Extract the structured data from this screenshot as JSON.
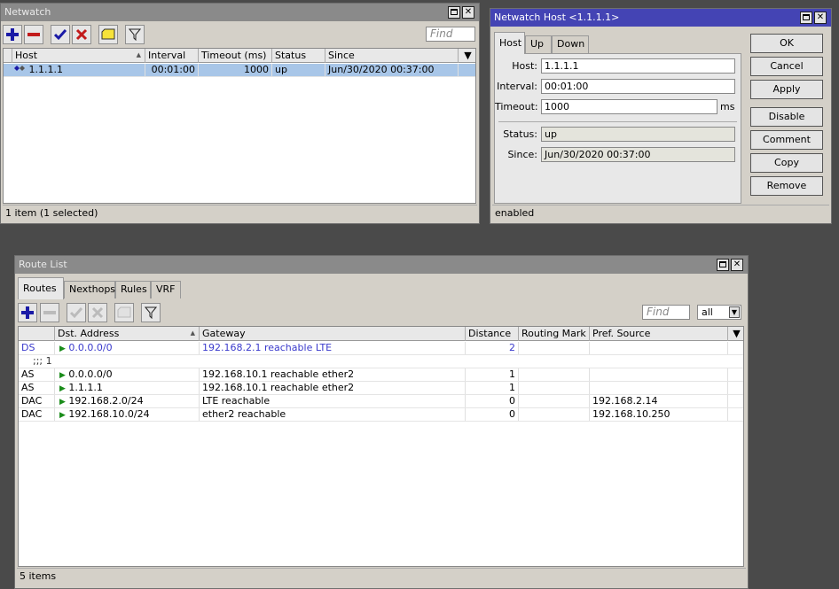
{
  "netwatch": {
    "title": "Netwatch",
    "find_placeholder": "Find",
    "columns": [
      "Host",
      "Interval",
      "Timeout (ms)",
      "Status",
      "Since"
    ],
    "rows": [
      {
        "host": "1.1.1.1",
        "interval": "00:01:00",
        "timeout": "1000",
        "status": "up",
        "since": "Jun/30/2020 00:37:00"
      }
    ],
    "status_text": "1 item (1 selected)"
  },
  "host_dialog": {
    "title": "Netwatch Host <1.1.1.1>",
    "tabs": [
      "Host",
      "Up",
      "Down"
    ],
    "fields": {
      "host_label": "Host:",
      "host_value": "1.1.1.1",
      "interval_label": "Interval:",
      "interval_value": "00:01:00",
      "timeout_label": "Timeout:",
      "timeout_value": "1000",
      "timeout_unit": "ms",
      "status_label": "Status:",
      "status_value": "up",
      "since_label": "Since:",
      "since_value": "Jun/30/2020 00:37:00"
    },
    "buttons": [
      "OK",
      "Cancel",
      "Apply",
      "Disable",
      "Comment",
      "Copy",
      "Remove"
    ],
    "status_text": "enabled"
  },
  "route_list": {
    "title": "Route List",
    "tabs": [
      "Routes",
      "Nexthops",
      "Rules",
      "VRF"
    ],
    "find_placeholder": "Find",
    "filter_value": "all",
    "columns": [
      "",
      "Dst. Address",
      "Gateway",
      "Distance",
      "Routing Mark",
      "Pref. Source"
    ],
    "rows": [
      {
        "flags": "DS",
        "dst": "0.0.0.0/0",
        "gateway": "192.168.2.1 reachable LTE",
        "distance": "2",
        "routing_mark": "",
        "pref_source": ""
      },
      {
        "comment": ";;; 1"
      },
      {
        "flags": "AS",
        "dst": "0.0.0.0/0",
        "gateway": "192.168.10.1 reachable ether2",
        "distance": "1",
        "routing_mark": "",
        "pref_source": ""
      },
      {
        "flags": "AS",
        "dst": "1.1.1.1",
        "gateway": "192.168.10.1 reachable ether2",
        "distance": "1",
        "routing_mark": "",
        "pref_source": ""
      },
      {
        "flags": "DAC",
        "dst": "192.168.2.0/24",
        "gateway": "LTE reachable",
        "distance": "0",
        "routing_mark": "",
        "pref_source": "192.168.2.14"
      },
      {
        "flags": "DAC",
        "dst": "192.168.10.0/24",
        "gateway": "ether2 reachable",
        "distance": "0",
        "routing_mark": "",
        "pref_source": "192.168.10.250"
      }
    ],
    "status_text": "5 items"
  },
  "colors": {
    "active_title": "#4444b4",
    "dynamic_row": "#3a3acc",
    "selected_row": "#a8c6e8"
  }
}
